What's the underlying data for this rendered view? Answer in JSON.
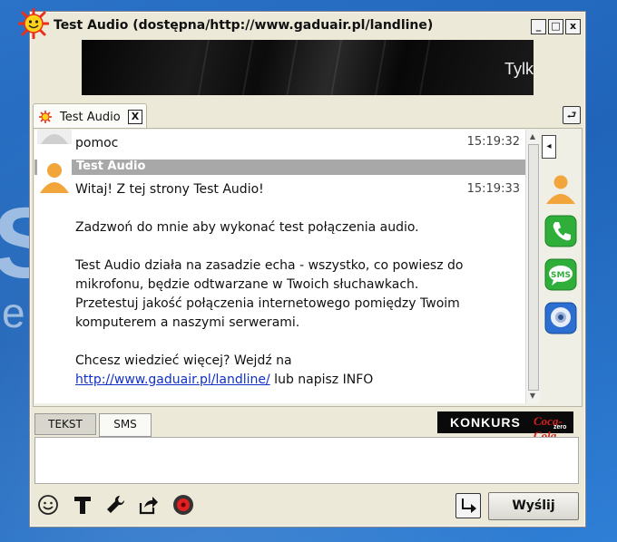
{
  "window": {
    "title": "Test Audio (dostępna/http://www.gaduair.pl/landline)",
    "minimize_label": "_",
    "maximize_label": "□",
    "close_label": "x"
  },
  "banner": {
    "text": "Tylk"
  },
  "tab": {
    "label": "Test Audio",
    "close_label": "X"
  },
  "detach_label": "⮐",
  "messages": [
    {
      "sender": "",
      "text": "pomoc",
      "time": "15:19:32"
    },
    {
      "sender": "Test Audio",
      "time": "15:19:33",
      "lines": [
        "Witaj! Z tej strony Test Audio!",
        "",
        "Zadzwoń do mnie aby wykonać test połączenia audio.",
        "",
        "Test Audio działa na zasadzie echa - wszystko, co powiesz do",
        "mikrofonu, będzie odtwarzane w Twoich słuchawkach.",
        "Przetestuj jakość połączenia internetowego pomiędzy Twoim",
        "komputerem a naszymi serwerami.",
        "",
        "Chcesz wiedzieć więcej? Wejdź na"
      ],
      "link": "http://www.gaduair.pl/landline/",
      "link_suffix": " lub napisz INFO"
    }
  ],
  "sidebar": {
    "collapse_label": "◂",
    "icons": [
      "contact-person-icon",
      "phone-call-icon",
      "sms-icon",
      "webcam-icon"
    ],
    "sms_text": "SMS"
  },
  "mode_tabs": [
    "TEKST",
    "SMS"
  ],
  "promo": {
    "text": "KONKURS",
    "brand": "Coca-Cola",
    "brand_sub": "zero"
  },
  "toolbar": {
    "icons": [
      "emoticon-icon",
      "text-format-icon",
      "tools-icon",
      "share-icon",
      "record-icon"
    ],
    "send_label": "Wyślij"
  },
  "colors": {
    "window_bg": "#ece9d8",
    "header_bar": "#a8a8a8",
    "link": "#1030c8",
    "desktop": "#2b73c8"
  }
}
